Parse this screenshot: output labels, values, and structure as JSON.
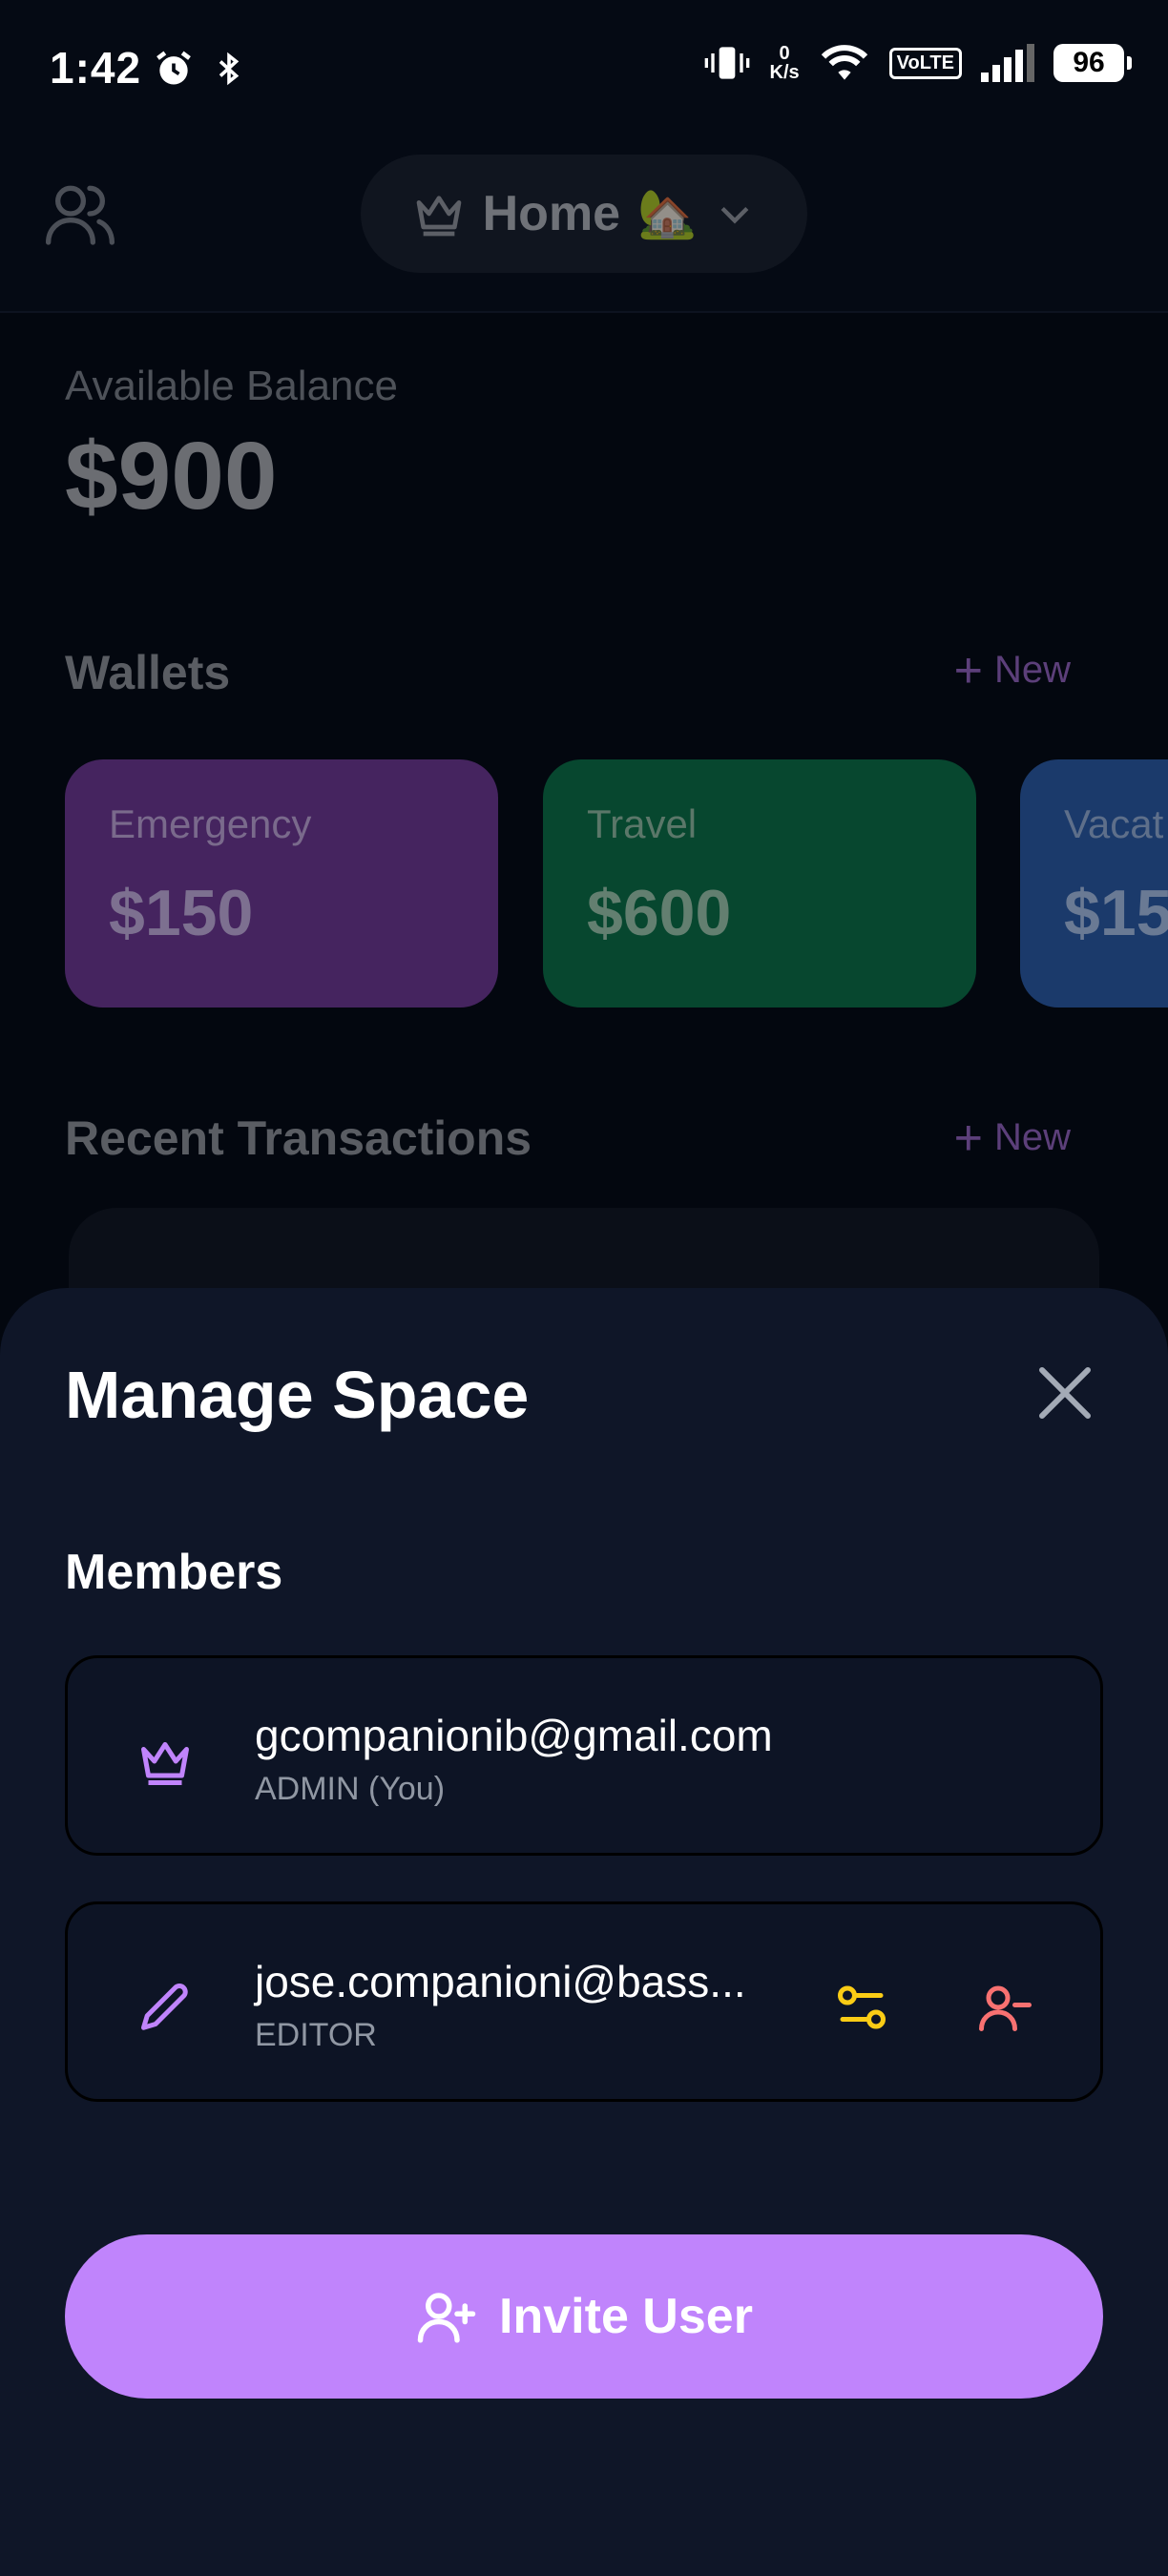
{
  "status_bar": {
    "time": "1:42",
    "net_speed_value": "0",
    "net_speed_unit": "K/s",
    "volte": "VoLTE",
    "battery": "96"
  },
  "header": {
    "space_name": "Home",
    "space_emoji": "🏡"
  },
  "balance": {
    "label": "Available Balance",
    "value": "$900"
  },
  "wallets": {
    "title": "Wallets",
    "new_label": "New",
    "items": [
      {
        "name": "Emergency",
        "amount": "$150",
        "color": "#45245f",
        "text_color": "#7a6a8c"
      },
      {
        "name": "Travel",
        "amount": "$600",
        "color": "#07472f",
        "text_color": "#5b7769"
      },
      {
        "name": "Vacat",
        "amount": "$15",
        "color": "#1b3a6b",
        "text_color": "#5e6f8a"
      }
    ]
  },
  "transactions": {
    "title": "Recent Transactions",
    "new_label": "New"
  },
  "sheet": {
    "title": "Manage Space",
    "members_title": "Members",
    "members": [
      {
        "email": "gcompanionib@gmail.com",
        "role": "ADMIN (You)",
        "icon": "crown-icon"
      },
      {
        "email": "jose.companioni@bass...",
        "role": "EDITOR",
        "icon": "pencil-icon"
      }
    ],
    "invite_label": "Invite User"
  },
  "colors": {
    "accent": "#c084fc",
    "sheet_bg": "#0f1628",
    "manage_role_icon": "#facc15",
    "remove_user_icon": "#f87171"
  }
}
